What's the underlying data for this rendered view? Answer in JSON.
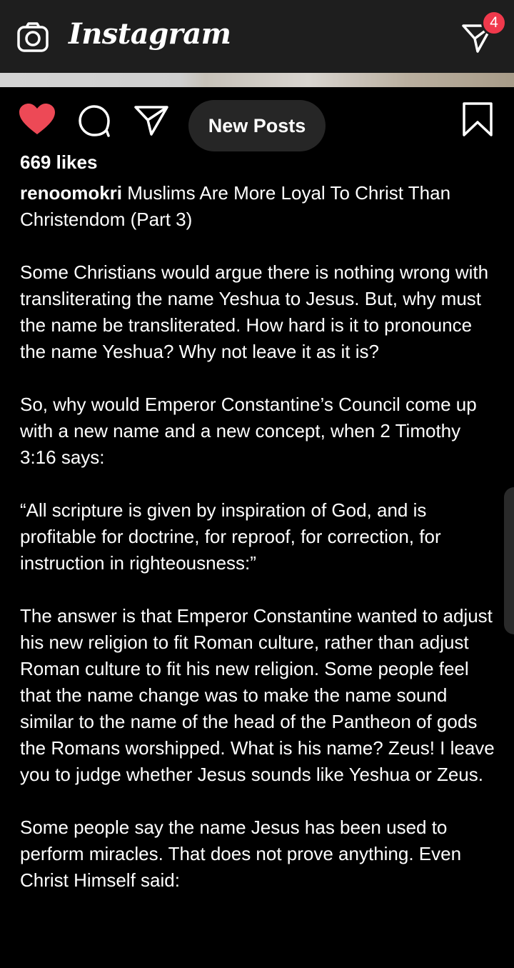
{
  "header": {
    "app_name": "Instagram",
    "camera_icon": "camera-icon",
    "direct_icon": "paper-plane-icon",
    "notification_count": "4"
  },
  "actions": {
    "like_icon": "heart-filled-icon",
    "comment_icon": "comment-icon",
    "share_icon": "paper-plane-icon",
    "save_icon": "bookmark-icon",
    "new_posts_label": "New Posts",
    "like_color": "#ed4956"
  },
  "post": {
    "likes": "669 likes",
    "username": "renoomokri",
    "title": "Muslims Are More Loyal To Christ Than Christendom (Part 3)",
    "paragraphs": [
      "Some Christians would argue there is nothing wrong with transliterating the name Yeshua to Jesus. But, why must the name be transliterated. How hard is it to pronounce the name Yeshua? Why not leave it as it is?",
      "So, why would Emperor Constantine’s Council come up with a new name and a new concept, when 2 Timothy 3:16 says:",
      "“All scripture is given by inspiration of God, and is profitable for doctrine, for reproof, for correction, for instruction in righteousness:”",
      "The answer is that Emperor Constantine wanted to adjust his new religion to fit Roman culture, rather than adjust Roman culture to fit his new religion. Some people feel that the name change was to make the name sound similar to the name of the head of the Pantheon of gods the Romans worshipped. What is his name? Zeus! I leave you to judge whether Jesus sounds like Yeshua or Zeus.",
      "Some people say the name Jesus has been used to perform miracles. That does not prove anything. Even Christ Himself said:"
    ]
  }
}
